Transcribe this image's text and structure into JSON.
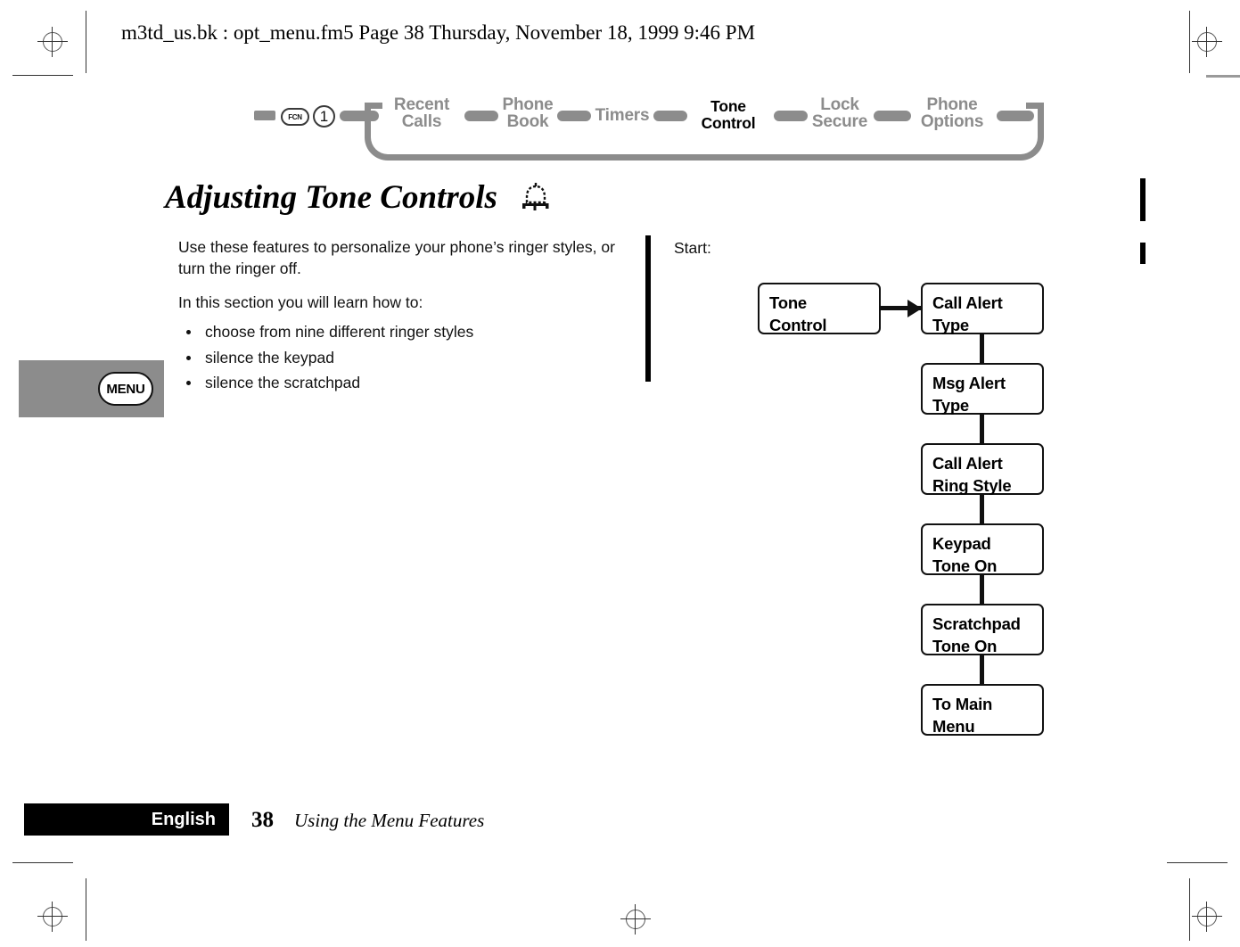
{
  "running_head": "m3td_us.bk : opt_menu.fm5  Page 38  Thursday, November 18, 1999  9:46 PM",
  "nav": {
    "fcn_key": "FCN",
    "number_key": "1",
    "items": [
      {
        "label": "Recent\nCalls",
        "current": false
      },
      {
        "label": "Phone\nBook",
        "current": false
      },
      {
        "label": "Timers",
        "current": false
      },
      {
        "label": "Tone\nControl",
        "current": true
      },
      {
        "label": "Lock\nSecure",
        "current": false
      },
      {
        "label": "Phone\nOptions",
        "current": false
      }
    ]
  },
  "heading": {
    "title": "Adjusting Tone Controls",
    "icon": "bell-icon"
  },
  "margin_tab": {
    "label": "MENU"
  },
  "body": {
    "intro": "Use these features to personalize your phone’s ringer styles, or turn the ringer off.",
    "lead_in": "In this section you will learn how to:",
    "bullets": [
      "choose from nine different ringer styles",
      "silence the keypad",
      "silence the scratchpad"
    ]
  },
  "flow": {
    "start_label": "Start:",
    "root": "Tone\nControl",
    "steps": [
      "Call Alert\nType",
      "Msg Alert\nType",
      "Call Alert\nRing Style",
      "Keypad\nTone On",
      "Scratchpad\nTone On",
      "To Main\nMenu"
    ]
  },
  "footer": {
    "language": "English",
    "page_number": "38",
    "section": "Using the Menu Features"
  },
  "colors": {
    "nav_inactive": "#8c8c8c",
    "nav_active": "#000000",
    "ink": "#000000",
    "paper": "#ffffff"
  }
}
